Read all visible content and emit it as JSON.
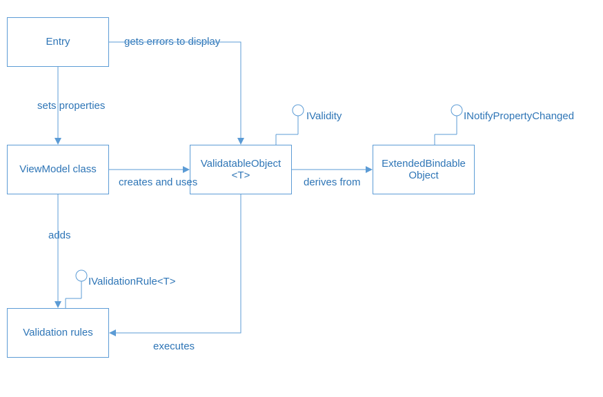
{
  "boxes": {
    "entry": "Entry",
    "viewmodel": "ViewModel class",
    "validatable": "ValidatableObject <T>",
    "extended": "ExtendedBindable Object",
    "rules": "Validation rules"
  },
  "edges": {
    "gets_errors": "gets errors to display",
    "sets_properties": "sets properties",
    "creates_uses": "creates and uses",
    "derives_from": "derives from",
    "adds": "adds",
    "executes": "executes"
  },
  "interfaces": {
    "ivalidity": "IValidity",
    "inotify": "INotifyPropertyChanged",
    "ivalidationrule": "IValidationRule<T>"
  }
}
